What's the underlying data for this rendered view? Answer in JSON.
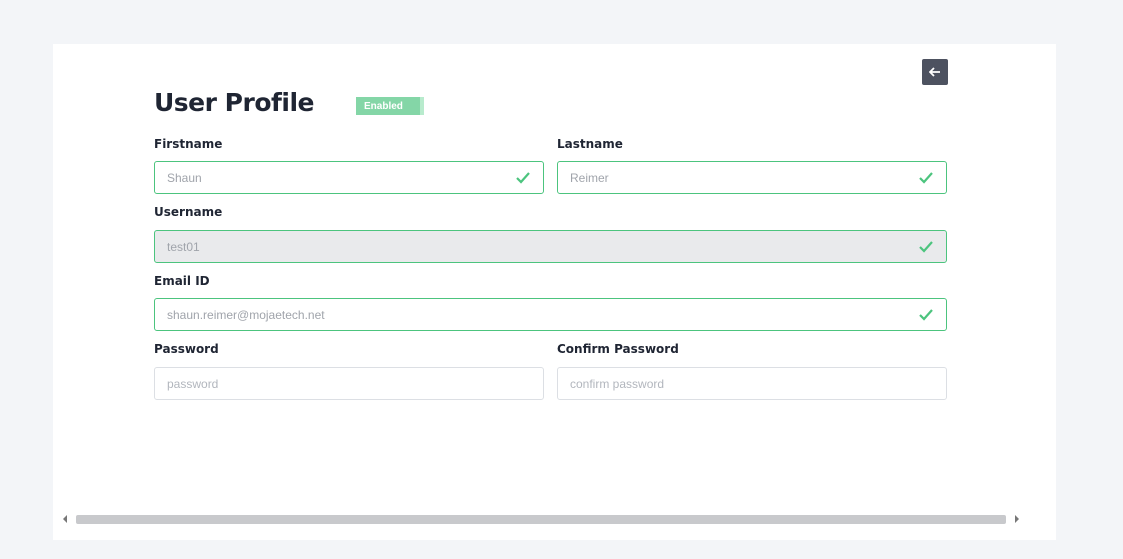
{
  "page": {
    "title": "User Profile",
    "status_badge": "Enabled"
  },
  "form": {
    "firstname": {
      "label": "Firstname",
      "value": "Shaun"
    },
    "lastname": {
      "label": "Lastname",
      "value": "Reimer"
    },
    "username": {
      "label": "Username",
      "value": "test01"
    },
    "email": {
      "label": "Email ID",
      "value": "shaun.reimer@mojaetech.net"
    },
    "password": {
      "label": "Password",
      "placeholder": "password"
    },
    "confirm_password": {
      "label": "Confirm Password",
      "placeholder": "confirm password"
    }
  },
  "colors": {
    "valid": "#4cc47e",
    "badge": "#84d6a7",
    "back_button": "#4d5260"
  },
  "icons": {
    "back": "arrow-left-icon",
    "valid": "check-icon"
  }
}
